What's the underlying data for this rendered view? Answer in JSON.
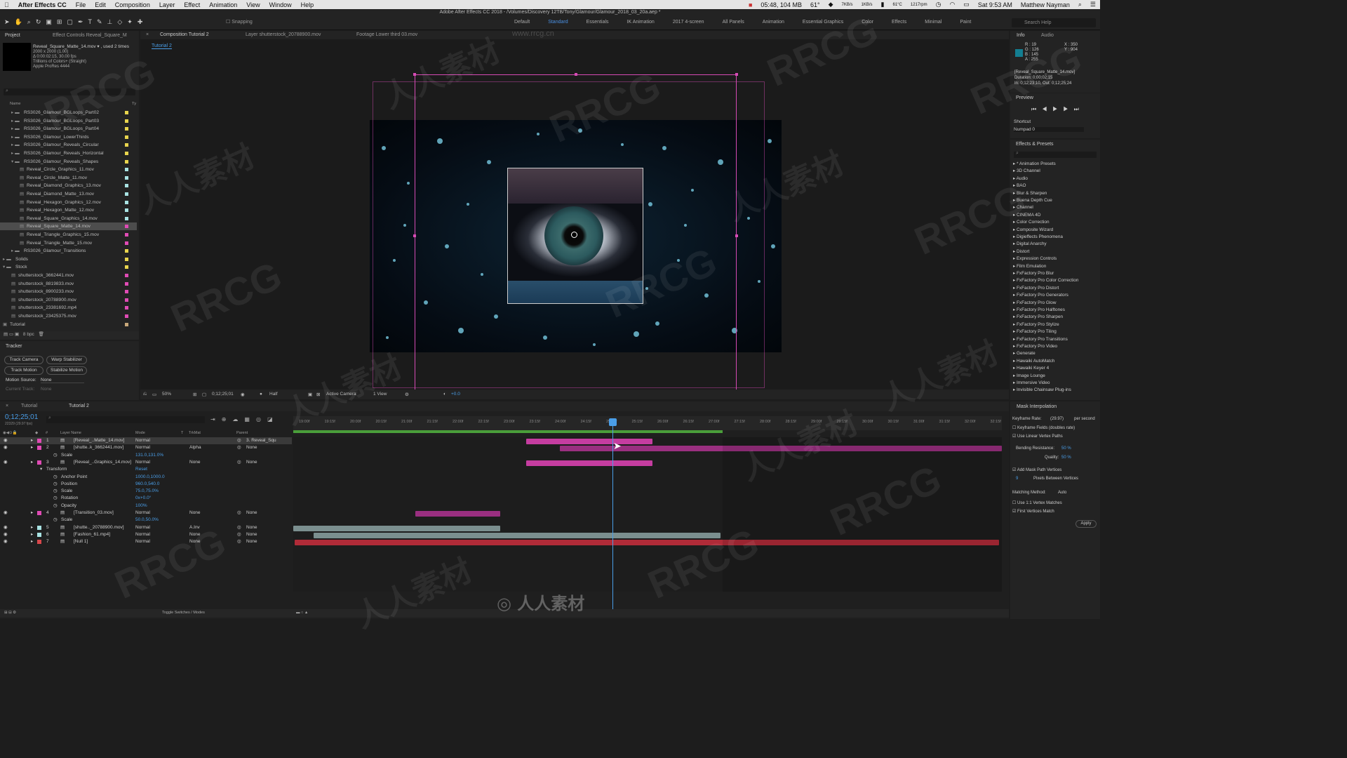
{
  "menubar": {
    "app_name": "After Effects CC",
    "items": [
      "File",
      "Edit",
      "Composition",
      "Layer",
      "Effect",
      "Animation",
      "View",
      "Window",
      "Help"
    ],
    "status_time": "05:48, 104 MB",
    "temp": "61°",
    "net_up": "7KB/s",
    "net_down": "1KB/s",
    "cpu_temp": "61°C",
    "rpm": "1217rpm",
    "datetime": "Sat 9:53 AM",
    "user": "Matthew Nayman"
  },
  "window_title": "Adobe After Effects CC 2018 - /Volumes/Discovery 12TB/Tony/Glamour/Glamour_2018_03_20a.aep *",
  "toolbar": {
    "snapping": "Snapping",
    "workspaces": [
      "Default",
      "Standard",
      "Essentials",
      "IK Animation",
      "2017 4-screen",
      "All Panels",
      "Animation",
      "Essential Graphics",
      "Color",
      "Effects",
      "Minimal",
      "Paint"
    ],
    "active_workspace": "Standard",
    "search_placeholder": "Search Help"
  },
  "project": {
    "tab": "Project",
    "effect_controls_tab": "Effect Controls Reveal_Square_M",
    "file_name": "Reveal_Square_Matte_14.mov ▾ , used 2 times",
    "info_lines": [
      "2000 x 2000 (1.00)",
      "Δ 0:00:02:15, 30.00 fps",
      "Trillions of Colors+ (Straight)",
      "Apple ProRes 4444"
    ],
    "col_name": "Name",
    "col_type": "Ty",
    "bpc": "8 bpc",
    "items": [
      {
        "label": "RS3026_Glamour_BGLoops_Part02",
        "indent": 1,
        "type": "folder",
        "color": "#e8d44d"
      },
      {
        "label": "RS3026_Glamour_BGLoops_Part03",
        "indent": 1,
        "type": "folder",
        "color": "#e8d44d"
      },
      {
        "label": "RS3026_Glamour_BGLoops_Part04",
        "indent": 1,
        "type": "folder",
        "color": "#e8d44d"
      },
      {
        "label": "RS3026_Glamour_LowerThirds",
        "indent": 1,
        "type": "folder",
        "color": "#e8d44d"
      },
      {
        "label": "RS3026_Glamour_Reveals_Circular",
        "indent": 1,
        "type": "folder",
        "color": "#e8d44d"
      },
      {
        "label": "RS3026_Glamour_Reveals_Horizontal",
        "indent": 1,
        "type": "folder",
        "color": "#e8d44d"
      },
      {
        "label": "RS3026_Glamour_Reveals_Shapes",
        "indent": 1,
        "type": "folder-open",
        "color": "#e8d44d"
      },
      {
        "label": "Reveal_Circle_Graphics_11.mov",
        "indent": 2,
        "type": "file",
        "color": "#a9e3e3"
      },
      {
        "label": "Reveal_Circle_Matte_11.mov",
        "indent": 2,
        "type": "file",
        "color": "#a9e3e3"
      },
      {
        "label": "Reveal_Diamond_Graphics_13.mov",
        "indent": 2,
        "type": "file",
        "color": "#a9e3e3"
      },
      {
        "label": "Reveal_Diamond_Matte_13.mov",
        "indent": 2,
        "type": "file",
        "color": "#a9e3e3"
      },
      {
        "label": "Reveal_Hexagon_Graphics_12.mov",
        "indent": 2,
        "type": "file",
        "color": "#a9e3e3"
      },
      {
        "label": "Reveal_Hexagon_Matte_12.mov",
        "indent": 2,
        "type": "file",
        "color": "#a9e3e3"
      },
      {
        "label": "Reveal_Square_Graphics_14.mov",
        "indent": 2,
        "type": "file",
        "color": "#a9e3e3"
      },
      {
        "label": "Reveal_Square_Matte_14.mov",
        "indent": 2,
        "type": "file",
        "color": "#e04bb5",
        "selected": true
      },
      {
        "label": "Reveal_Triangle_Graphics_15.mov",
        "indent": 2,
        "type": "file",
        "color": "#e04bb5"
      },
      {
        "label": "Reveal_Triangle_Matte_15.mov",
        "indent": 2,
        "type": "file",
        "color": "#e04bb5"
      },
      {
        "label": "RS3026_Glamour_Transitions",
        "indent": 1,
        "type": "folder",
        "color": "#e8d44d"
      },
      {
        "label": "Solids",
        "indent": 0,
        "type": "folder",
        "color": "#e8d44d"
      },
      {
        "label": "Stock",
        "indent": 0,
        "type": "folder-open",
        "color": "#e8d44d"
      },
      {
        "label": "shutterstock_3662441.mov",
        "indent": 1,
        "type": "file",
        "color": "#e04bb5"
      },
      {
        "label": "shutterstock_8819833.mov",
        "indent": 1,
        "type": "file",
        "color": "#e04bb5"
      },
      {
        "label": "shutterstock_8900233.mov",
        "indent": 1,
        "type": "file",
        "color": "#e04bb5"
      },
      {
        "label": "shutterstock_20788900.mov",
        "indent": 1,
        "type": "file",
        "color": "#e04bb5"
      },
      {
        "label": "shutterstock_23381692.mp4",
        "indent": 1,
        "type": "file",
        "color": "#e04bb5"
      },
      {
        "label": "shutterstock_23425375.mov",
        "indent": 1,
        "type": "file",
        "color": "#e04bb5"
      },
      {
        "label": "Tutorial",
        "indent": 0,
        "type": "comp",
        "color": "#c8a87a"
      }
    ]
  },
  "tracker": {
    "tab": "Tracker",
    "buttons": [
      "Track Camera",
      "Warp Stabilizer",
      "Track Motion",
      "Stabilize Motion"
    ],
    "motion_source_label": "Motion Source:",
    "motion_source_value": "None",
    "current_track_label": "Current Track:",
    "current_track_value": "None"
  },
  "viewer": {
    "tabs": [
      "Composition Tutorial 2",
      "Layer shutterstock_20788900.mov",
      "Footage Lower third 03.mov"
    ],
    "sub_tab": "Tutorial 2",
    "zoom": "50%",
    "timecode": "0;12;25;01",
    "resolution": "Half",
    "camera": "Active Camera",
    "views": "1 View",
    "exposure": "+0.0"
  },
  "info": {
    "tab": "Info",
    "audio_tab": "Audio",
    "r": "R : 19",
    "g": "G : 126",
    "b": "B : 145",
    "a": "A : 255",
    "x": "X : 350",
    "y": "Y : 904",
    "layer": "[Reveal_Square_Matte_14.mov]",
    "duration": "Duration: 0;00;02;15",
    "inout": "In: 0;12;23;10, Out: 0;12;25;24",
    "color": "#137e91"
  },
  "preview": {
    "tab": "Preview",
    "shortcut_label": "Shortcut",
    "shortcut_value": "Numpad 0"
  },
  "effects": {
    "tab": "Effects & Presets",
    "items": [
      "* Animation Presets",
      "3D Channel",
      "Audio",
      "BAO",
      "Blur & Sharpen",
      "Buena Depth Cue",
      "Channel",
      "CINEMA 4D",
      "Color Correction",
      "Composite Wizard",
      "Digieffects Phenomena",
      "Digital Anarchy",
      "Distort",
      "Expression Controls",
      "Film Emulation",
      "FxFactory Pro Blur",
      "FxFactory Pro Color Correction",
      "FxFactory Pro Distort",
      "FxFactory Pro Generators",
      "FxFactory Pro Glow",
      "FxFactory Pro Halftones",
      "FxFactory Pro Sharpen",
      "FxFactory Pro Stylize",
      "FxFactory Pro Tiling",
      "FxFactory Pro Transitions",
      "FxFactory Pro Video",
      "Generate",
      "Hawaiki AutoMatch",
      "Hawaiki Keyer 4",
      "Image Lounge",
      "Immersive Video",
      "Invisible Chainsaw Plug-ins"
    ]
  },
  "timeline": {
    "tabs": [
      "Tutorial",
      "Tutorial 2"
    ],
    "timecode": "0;12;25;01",
    "frame": "22329 (29.97 fps)",
    "col_layer": "Layer Name",
    "col_mode": "Mode",
    "col_t": "T",
    "col_trkmat": "TrkMat",
    "col_parent": "Parent",
    "ruler": [
      "19:00f",
      "19:15f",
      "20:00f",
      "20:15f",
      "21:00f",
      "21:15f",
      "22:00f",
      "22:15f",
      "23:00f",
      "23:15f",
      "24:00f",
      "24:15f",
      "25:00f",
      "25:15f",
      "26:00f",
      "26:15f",
      "27:00f",
      "27:15f",
      "28:00f",
      "28:15f",
      "29:00f",
      "29:15f",
      "30:00f",
      "30:15f",
      "31:00f",
      "31:15f",
      "32:00f",
      "32:15f"
    ],
    "layers": [
      {
        "num": "1",
        "name": "[Reveal_..Matte_14.mov]",
        "mode": "Normal",
        "trkmat": "",
        "parent": "3. Reveal_Squ",
        "color": "#e04bb5",
        "selected": true
      },
      {
        "num": "2",
        "name": "[shutte..k_3662441.mov]",
        "mode": "Normal",
        "trkmat": "Alpha",
        "parent": "None",
        "color": "#e04bb5"
      },
      {
        "prop": "Scale",
        "value": "131.0,131.0%"
      },
      {
        "num": "3",
        "name": "[Reveal_..Graphics_14.mov]",
        "mode": "Normal",
        "trkmat": "None",
        "parent": "None",
        "color": "#e04bb5"
      },
      {
        "group": "Transform",
        "value": "Reset"
      },
      {
        "prop": "Anchor Point",
        "value": "1000.0,1000.0"
      },
      {
        "prop": "Position",
        "value": "960.0,540.0"
      },
      {
        "prop": "Scale",
        "value": "75.0,75.0%"
      },
      {
        "prop": "Rotation",
        "value": "0x+0.0°"
      },
      {
        "prop": "Opacity",
        "value": "100%"
      },
      {
        "num": "4",
        "name": "[Transition_03.mov]",
        "mode": "Normal",
        "trkmat": "None",
        "parent": "None",
        "color": "#e04bb5"
      },
      {
        "prop": "Scale",
        "value": "50.0,50.0%"
      },
      {
        "num": "5",
        "name": "[shutte.._20788900.mov]",
        "mode": "Normal",
        "trkmat": "A.Inv",
        "parent": "None",
        "color": "#a9e3e3"
      },
      {
        "num": "6",
        "name": "[Fashion_61.mp4]",
        "mode": "Normal",
        "trkmat": "None",
        "parent": "None",
        "color": "#a9e3e3"
      },
      {
        "num": "7",
        "name": "[Null 1]",
        "mode": "Normal",
        "trkmat": "None",
        "parent": "None",
        "color": "#d9474b"
      }
    ],
    "toggle_label": "Toggle Switches / Modes"
  },
  "mask": {
    "tab": "Mask Interpolation",
    "keyframe_rate_label": "Keyframe Rate:",
    "keyframe_rate_value": "(29.97)",
    "per_second": "per second",
    "keyframe_fields": "Keyframe Fields (doubles rate)",
    "linear_vertex": "Use Linear Vertex Paths",
    "bending_label": "Bending Resistance:",
    "bending_value": "50 %",
    "quality_label": "Quality:",
    "quality_value": "50 %",
    "add_mask": "Add Mask Path Vertices",
    "pixels_num": "9",
    "pixels_between": "Pixels Between Vertices",
    "matching_label": "Matching Method:",
    "matching_value": "Auto",
    "use_11": "Use 1:1 Vertex Matches",
    "first_vertices": "First Vertices Match",
    "apply": "Apply"
  },
  "watermark": {
    "latin": "RRCG",
    "cjk": "人人素材",
    "site": "www.rrcg.cn"
  }
}
